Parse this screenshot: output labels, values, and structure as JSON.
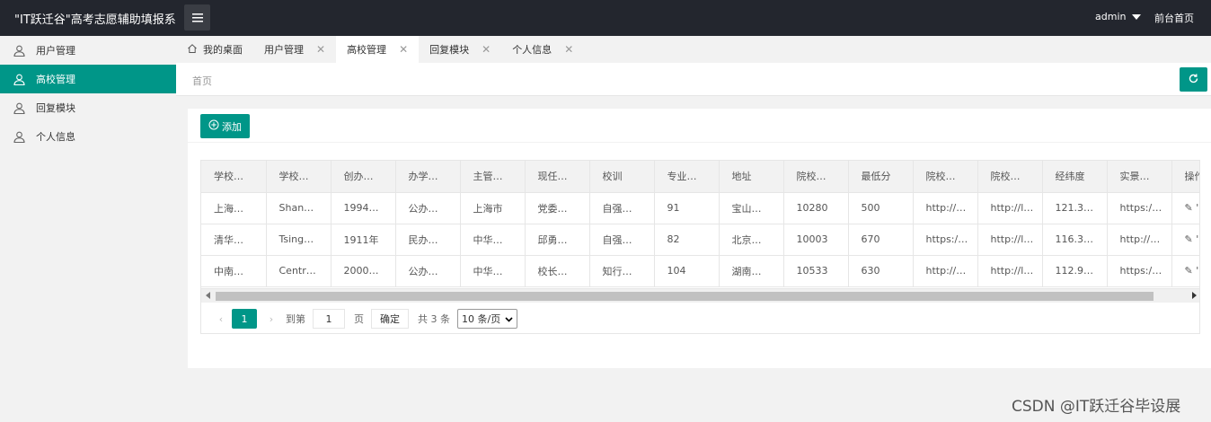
{
  "header": {
    "brand": "\"IT跃迁谷\"高考志愿辅助填报系",
    "user": "admin",
    "front_link": "前台首页"
  },
  "sidebar": {
    "items": [
      {
        "label": "用户管理",
        "icon": "user-icon",
        "active": false
      },
      {
        "label": "高校管理",
        "icon": "user-icon",
        "active": true
      },
      {
        "label": "回复模块",
        "icon": "user-icon",
        "active": false
      },
      {
        "label": "个人信息",
        "icon": "user-icon",
        "active": false
      }
    ]
  },
  "tabs": [
    {
      "label": "我的桌面",
      "icon": "home-icon",
      "closable": false
    },
    {
      "label": "用户管理",
      "closable": true
    },
    {
      "label": "高校管理",
      "closable": true,
      "active": true
    },
    {
      "label": "回复模块",
      "closable": true
    },
    {
      "label": "个人信息",
      "closable": true
    }
  ],
  "breadcrumb": "首页",
  "toolbar": {
    "add_label": "添加"
  },
  "table": {
    "columns": [
      "学校…",
      "学校…",
      "创办…",
      "办学…",
      "主管…",
      "现任…",
      "校训",
      "专业…",
      "地址",
      "院校…",
      "最低分",
      "院校…",
      "院校…",
      "经纬度",
      "实景…",
      "操作"
    ],
    "rows": [
      [
        "上海…",
        "Shan…",
        "1994…",
        "公办…",
        "上海市",
        "党委…",
        "自强…",
        "91",
        "宝山…",
        "10280",
        "500",
        "http://…",
        "http://l…",
        "121.3…",
        "https:/…",
        "✎ '"
      ],
      [
        "清华…",
        "Tsing…",
        "1911年",
        "民办…",
        "中华…",
        "邱勇…",
        "自强…",
        "82",
        "北京…",
        "10003",
        "670",
        "https:/…",
        "http://l…",
        "116.3…",
        "http://…",
        "✎ '"
      ],
      [
        "中南…",
        "Centr…",
        "2000…",
        "公办…",
        "中华…",
        "校长…",
        "知行…",
        "104",
        "湖南…",
        "10533",
        "630",
        "http://…",
        "http://l…",
        "112.9…",
        "https:/…",
        "✎ '"
      ]
    ]
  },
  "pagination": {
    "current": "1",
    "goto_label": "到第",
    "goto_value": "1",
    "page_unit": "页",
    "confirm": "确定",
    "total": "共 3 条",
    "page_size": "10 条/页"
  },
  "watermark": "CSDN @IT跃迁谷毕设展",
  "colors": {
    "accent": "#009688",
    "topbar": "#23262e"
  }
}
